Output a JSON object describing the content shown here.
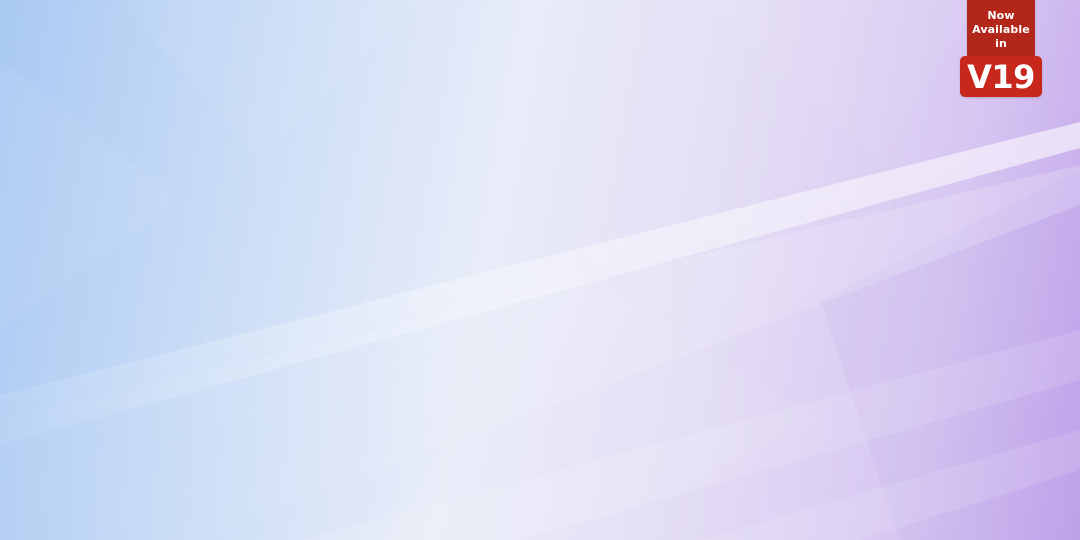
{
  "badge": {
    "line1": "Now",
    "line2": "Available",
    "line3": "in",
    "version": "V19"
  },
  "colors": {
    "badge_red": "#c8281c",
    "badge_red_dark": "#b2271a",
    "background_left": "#a9c9f3",
    "background_center": "#e8ecf8",
    "background_right": "#c2a4ea"
  }
}
